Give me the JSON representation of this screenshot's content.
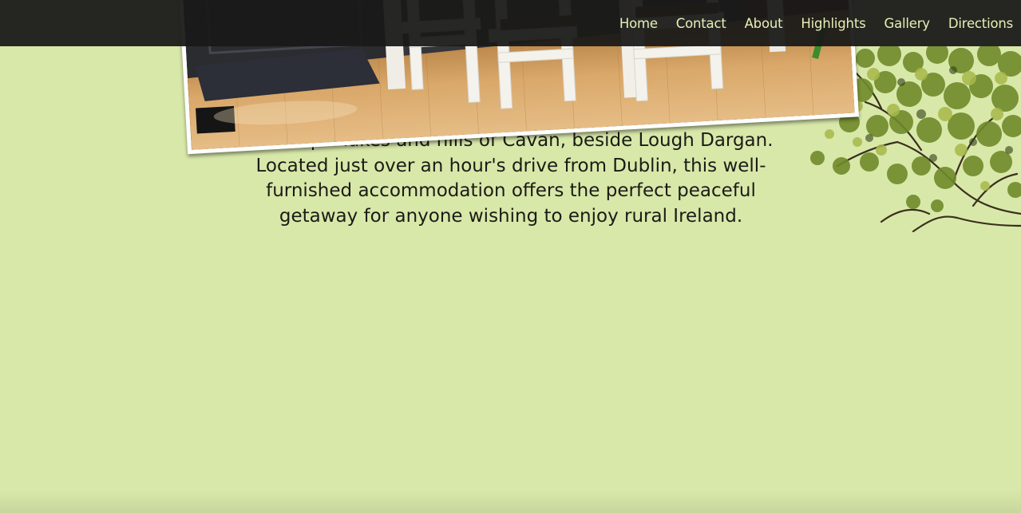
{
  "nav": {
    "items": [
      {
        "label": "Home"
      },
      {
        "label": "Contact"
      },
      {
        "label": "About"
      },
      {
        "label": "Highlights"
      },
      {
        "label": "Gallery"
      },
      {
        "label": "Directions"
      }
    ]
  },
  "main": {
    "intro": "...tranquil lakes and hills of Cavan, beside Lough Dargan. Located just over an hour's drive from Dublin, this well-furnished accommodation offers the perfect peaceful getaway for anyone wishing to enjoy rural Ireland."
  },
  "colors": {
    "page_background": "#d8e8a9",
    "navbar_background": "#1a1a18",
    "nav_text": "#e6f0b6",
    "body_text": "#1b1b16"
  }
}
